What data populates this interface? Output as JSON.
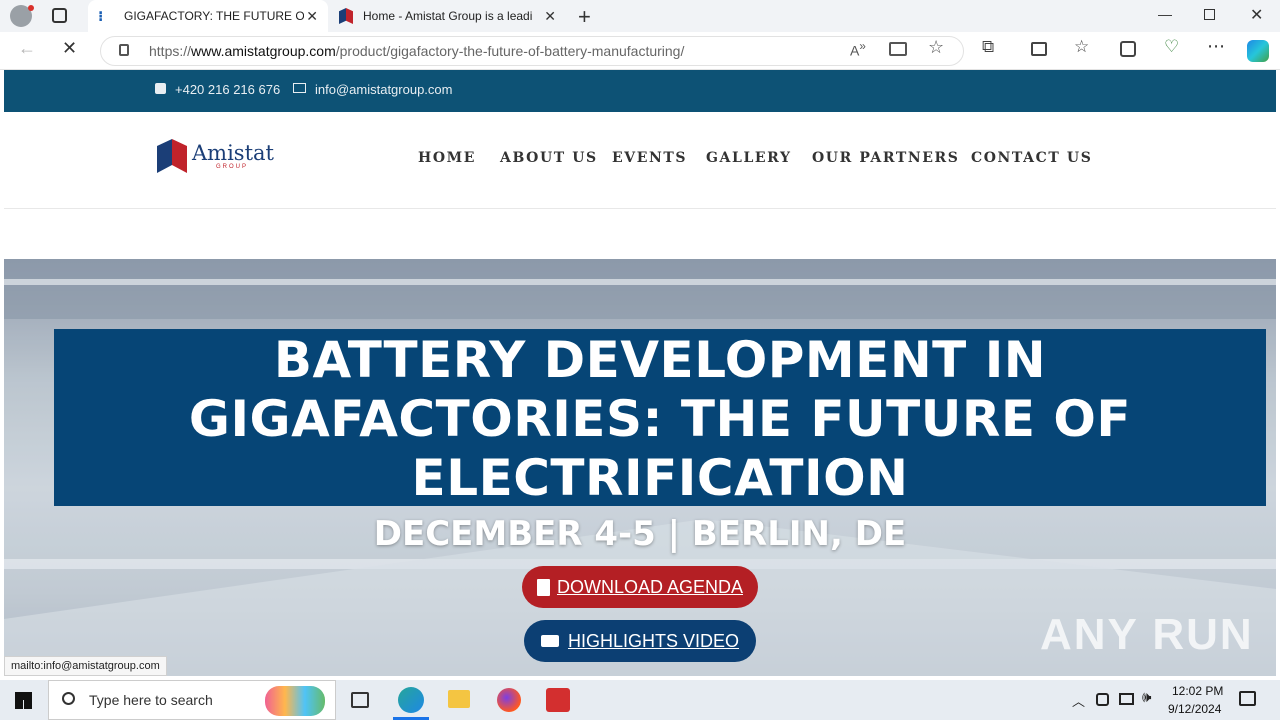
{
  "browser": {
    "tabs": [
      {
        "label": "GIGAFACTORY: THE FUTURE OF B",
        "active": true
      },
      {
        "label": "Home - Amistat Group is a leadi",
        "active": false
      }
    ],
    "url_domain": "www.amistatgroup.com",
    "url_path": "/product/gigafactory-the-future-of-battery-manufacturing/",
    "url_prefix": "https://",
    "status_text": "mailto:info@amistatgroup.com"
  },
  "topbar": {
    "phone": "+420 216 216 676",
    "email": "info@amistatgroup.com"
  },
  "logo": {
    "name": "Amistat",
    "sub": "GROUP"
  },
  "nav": [
    "HOME",
    "ABOUT US",
    "EVENTS",
    "GALLERY",
    "OUR PARTNERS",
    "CONTACT US"
  ],
  "hero": {
    "title_lines": [
      "BATTERY DEVELOPMENT IN",
      "GIGAFACTORIES: THE FUTURE OF",
      "ELECTRIFICATION"
    ],
    "date": "DECEMBER 4-5 | BERLIN, DE",
    "button_agenda": "DOWNLOAD AGENDA",
    "button_video": "HIGHLIGHTS VIDEO"
  },
  "watermark": "ANY RUN",
  "taskbar": {
    "search_placeholder": "Type here to search",
    "time": "12:02 PM",
    "date": "9/12/2024"
  },
  "colors": {
    "brand_dark": "#0d5275",
    "title_box": "#064576",
    "agenda_red": "#b41f24",
    "video_blue": "#0c3f73"
  }
}
